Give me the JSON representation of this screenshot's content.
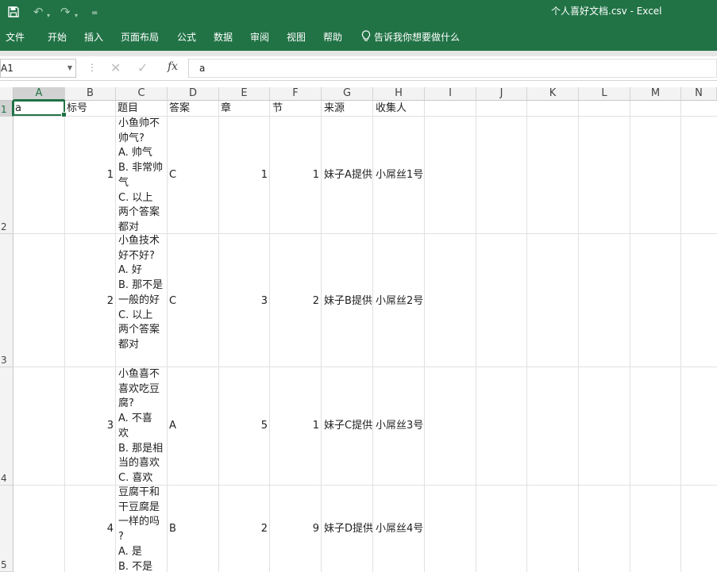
{
  "window": {
    "title": "个人喜好文档.csv  -  Excel"
  },
  "quick_access": {
    "save_icon": "save-icon",
    "undo_icon": "undo-icon",
    "redo_icon": "redo-icon",
    "customize_icon": "customize-icon"
  },
  "ribbon": {
    "tabs": [
      "文件",
      "开始",
      "插入",
      "页面布局",
      "公式",
      "数据",
      "审阅",
      "视图",
      "帮助"
    ],
    "tell_me": "告诉我你想要做什么",
    "tell_me_icon": "lightbulb-icon"
  },
  "formula_bar": {
    "name_box": "A1",
    "formula": "a",
    "fx_label": "fx"
  },
  "colors": {
    "accent": "#217346"
  },
  "sheet": {
    "columns": [
      "A",
      "B",
      "C",
      "D",
      "E",
      "F",
      "G",
      "H",
      "I",
      "J",
      "K",
      "L",
      "M",
      "N"
    ],
    "row_numbers": [
      "1",
      "2",
      "3",
      "4",
      "5"
    ],
    "headers": [
      "a",
      "标号",
      "题目",
      "答案",
      "章",
      "节",
      "来源",
      "收集人"
    ],
    "rows": [
      {
        "id": "1",
        "question": "小鱼帅不\n帅气?\nA. 帅气\nB. 非常帅\n气\nC. 以上\n两个答案\n都对",
        "answer": "C",
        "chapter": "1",
        "section": "1",
        "source": "妹子A提供",
        "collector": "小屌丝1号"
      },
      {
        "id": "2",
        "question": "小鱼技术\n好不好?\nA. 好\nB. 那不是\n一般的好\nC. 以上\n两个答案\n都对",
        "answer": "C",
        "chapter": "3",
        "section": "2",
        "source": "妹子B提供",
        "collector": "小屌丝2号"
      },
      {
        "id": "3",
        "question": "小鱼喜不\n喜欢吃豆\n腐?\nA. 不喜\n欢\nB. 那是相\n当的喜欢\nC. 喜欢",
        "answer": "A",
        "chapter": "5",
        "section": "1",
        "source": "妹子C提供",
        "collector": "小屌丝3号"
      },
      {
        "id": "4",
        "question": "豆腐干和\n干豆腐是\n一样的吗\n?\nA. 是\nB. 不是",
        "answer": "B",
        "chapter": "2",
        "section": "9",
        "source": "妹子D提供",
        "collector": "小屌丝4号"
      }
    ]
  }
}
